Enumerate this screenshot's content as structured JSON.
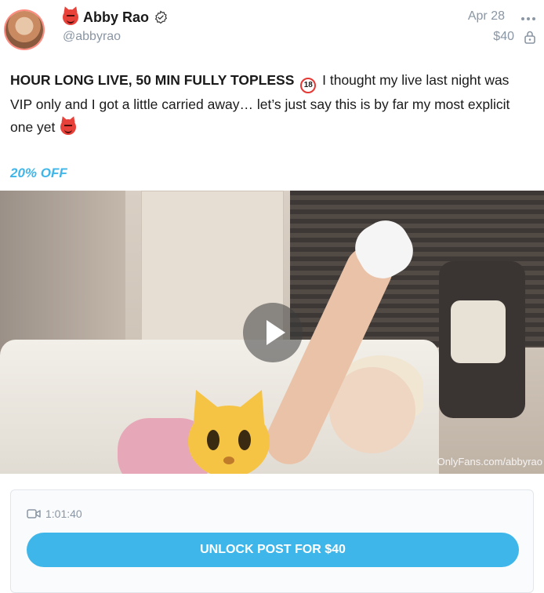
{
  "header": {
    "display_name": "Abby Rao",
    "username": "@abbyrao",
    "date": "Apr 28",
    "price": "$40",
    "icons": [
      "devil-emoji",
      "verified-badge-icon",
      "more-options-icon",
      "lock-icon"
    ]
  },
  "post": {
    "text_bold": "HOUR LONG LIVE, 50 MIN FULLY TOPLESS",
    "text_badge": "18",
    "text_rest": " I thought my live last night was VIP only and I got a little carried away… let’s just say this is by far my most explicit one yet ",
    "discount": "20% OFF"
  },
  "media": {
    "watermark": "OnlyFans.com/abbyrao",
    "icons": [
      "play-icon",
      "cat-emoji"
    ]
  },
  "unlock": {
    "duration": "1:01:40",
    "button_label": "UNLOCK POST FOR $40"
  },
  "colors": {
    "accent": "#3fb6ea",
    "muted_text": "#8a96a3"
  }
}
